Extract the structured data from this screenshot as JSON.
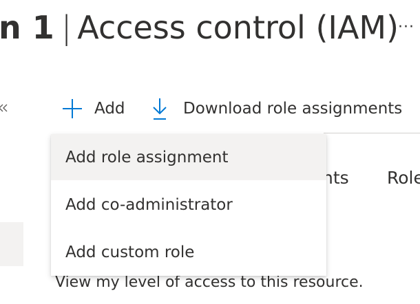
{
  "header": {
    "title_prefix": "n 1",
    "separator": "|",
    "title_main": "Access control (IAM)",
    "more_label": "···"
  },
  "toolbar": {
    "add_label": "Add",
    "download_label": "Download role assignments"
  },
  "tabs": {
    "partial_1": "nts",
    "partial_2": "Role"
  },
  "add_menu": {
    "items": [
      {
        "label": "Add role assignment",
        "highlighted": true
      },
      {
        "label": "Add co-administrator",
        "highlighted": false
      },
      {
        "label": "Add custom role",
        "highlighted": false
      }
    ]
  },
  "content": {
    "view_access_text": "View my level of access to this resource."
  },
  "icons": {
    "add": "plus-icon",
    "download": "download-icon",
    "collapse": "double-chevron-left-icon"
  },
  "colors": {
    "accent": "#0078d4",
    "text": "#323130",
    "hover_bg": "#f3f2f1"
  }
}
